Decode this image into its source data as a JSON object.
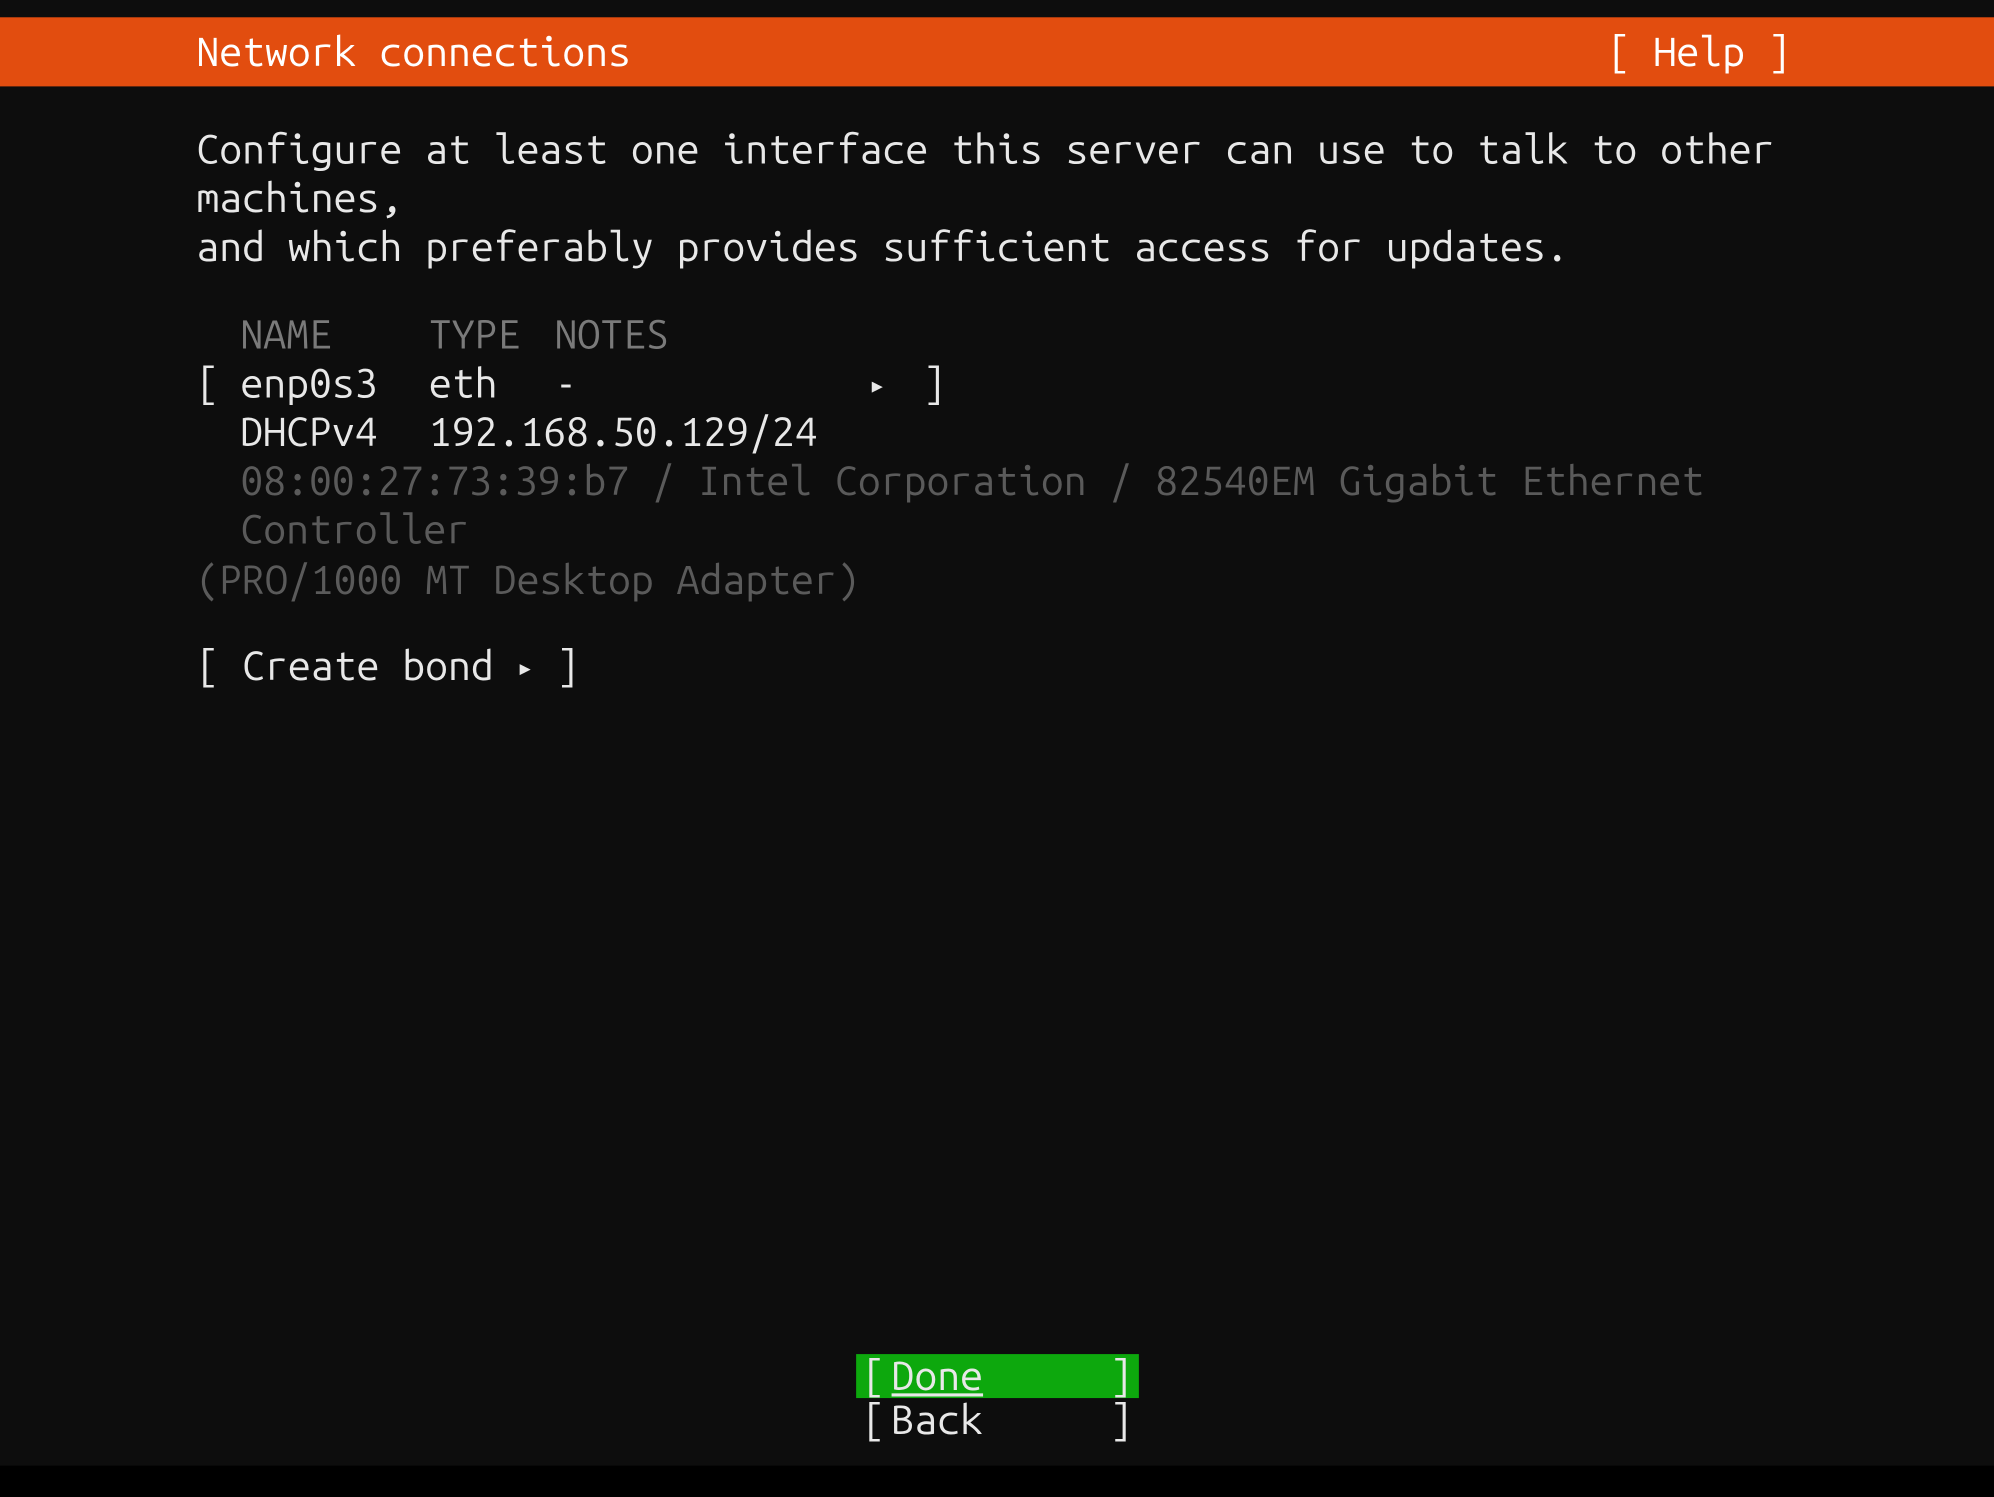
{
  "header": {
    "title": "Network connections",
    "help_label": "[ Help ]"
  },
  "description": "Configure at least one interface this server can use to talk to other machines,\nand which preferably provides sufficient access for updates.",
  "table": {
    "headers": {
      "name": "NAME",
      "type": "TYPE",
      "notes": "NOTES"
    },
    "interface": {
      "name": "enp0s3",
      "type": "eth",
      "notes": "-",
      "dhcp_mode": "DHCPv4",
      "address": "192.168.50.129/24",
      "hw_line": "08:00:27:73:39:b7 / Intel Corporation / 82540EM Gigabit Ethernet Controller",
      "hw_line2": "(PRO/1000 MT Desktop Adapter)"
    }
  },
  "create_bond_label": "Create bond",
  "footer": {
    "done_label": "Done",
    "back_label": "Back"
  },
  "glyphs": {
    "triangle": "▸"
  }
}
